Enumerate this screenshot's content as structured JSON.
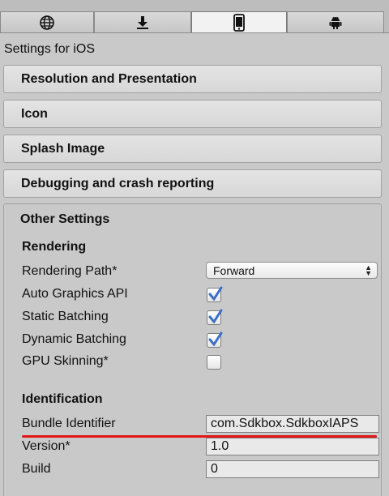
{
  "tabs": [
    {
      "icon": "globe-icon",
      "active": false
    },
    {
      "icon": "download-icon",
      "active": false
    },
    {
      "icon": "phone-icon",
      "active": true
    },
    {
      "icon": "android-icon",
      "active": false
    }
  ],
  "settings_title": "Settings for iOS",
  "sections": {
    "resolution": "Resolution and Presentation",
    "icon": "Icon",
    "splash": "Splash Image",
    "debugging": "Debugging and crash reporting",
    "other": "Other Settings"
  },
  "rendering": {
    "title": "Rendering",
    "rendering_path_label": "Rendering Path*",
    "rendering_path_value": "Forward",
    "auto_graphics_label": "Auto Graphics API",
    "auto_graphics_checked": true,
    "static_batching_label": "Static Batching",
    "static_batching_checked": true,
    "dynamic_batching_label": "Dynamic Batching",
    "dynamic_batching_checked": true,
    "gpu_skinning_label": "GPU Skinning*",
    "gpu_skinning_checked": false
  },
  "identification": {
    "title": "Identification",
    "bundle_label": "Bundle Identifier",
    "bundle_value": "com.Sdkbox.SdkboxIAPS",
    "version_label": "Version*",
    "version_value": "1.0",
    "build_label": "Build",
    "build_value": "0"
  },
  "colors": {
    "highlight_underline": "#e01818",
    "checkmark": "#3a6fc4"
  }
}
